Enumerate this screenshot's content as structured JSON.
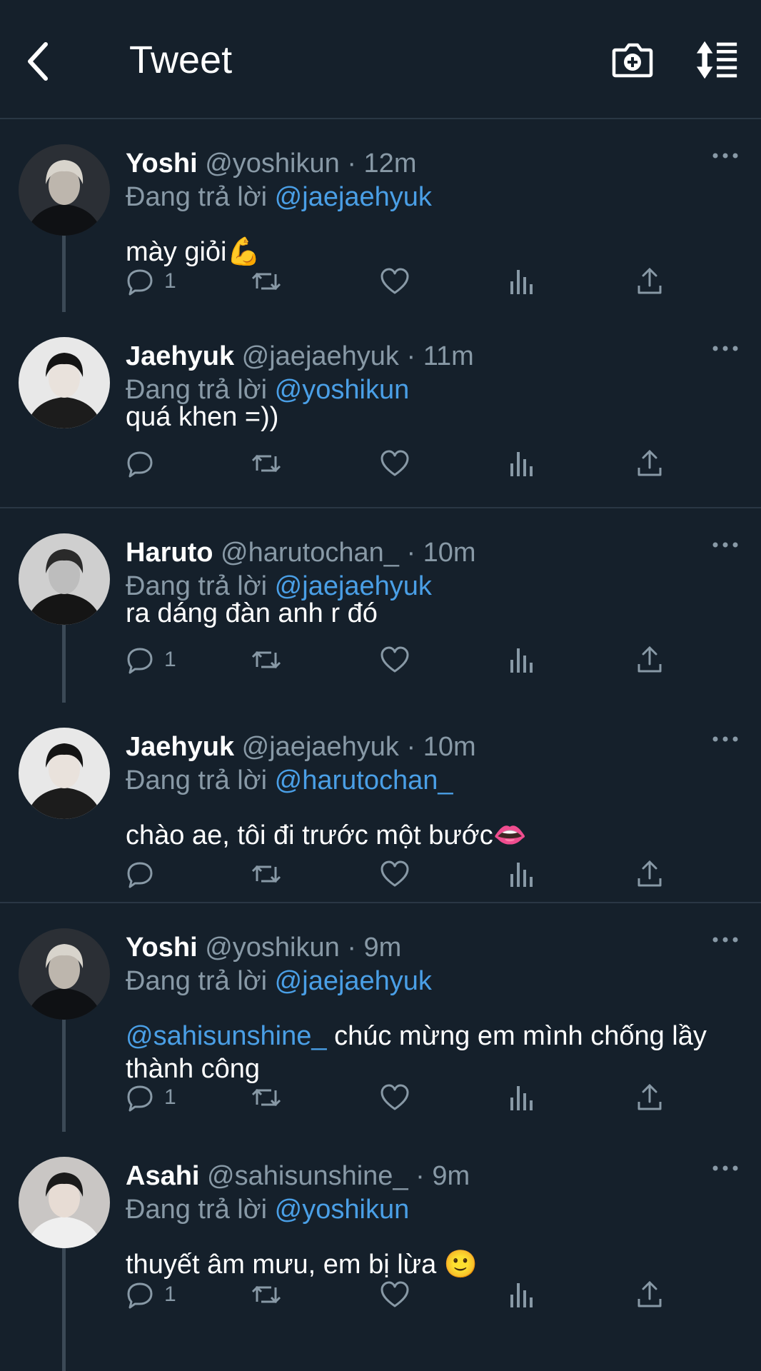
{
  "header": {
    "title": "Tweet"
  },
  "colors": {
    "background": "#15202b",
    "mention": "#4a9fe6",
    "secondary": "#8899a6"
  },
  "reply_prefix": "Đang trả lời",
  "tweets": [
    {
      "name": "Yoshi",
      "handle": "@yoshikun",
      "dot": "·",
      "time": "12m",
      "reply_to": "@jaejaehyuk",
      "mention": "",
      "text": "mày giỏi💪",
      "reply_count": "1"
    },
    {
      "name": "Jaehyuk",
      "handle": "@jaejaehyuk",
      "dot": "·",
      "time": "11m",
      "reply_to": "@yoshikun",
      "mention": "",
      "text": "quá khen =))",
      "reply_count": ""
    },
    {
      "name": "Haruto",
      "handle": "@harutochan_",
      "dot": "·",
      "time": "10m",
      "reply_to": "@jaejaehyuk",
      "mention": "",
      "text": "ra dáng đàn anh r đó",
      "reply_count": "1"
    },
    {
      "name": "Jaehyuk",
      "handle": "@jaejaehyuk",
      "dot": "·",
      "time": "10m",
      "reply_to": "@harutochan_",
      "mention": "",
      "text": "chào ae, tôi đi trước một bước👄",
      "reply_count": ""
    },
    {
      "name": "Yoshi",
      "handle": "@yoshikun",
      "dot": "·",
      "time": "9m",
      "reply_to": "@jaejaehyuk",
      "mention": "@sahisunshine_",
      "text": " chúc mừng em mình chống lầy thành công",
      "reply_count": "1"
    },
    {
      "name": "Asahi",
      "handle": "@sahisunshine_",
      "dot": "·",
      "time": "9m",
      "reply_to": "@yoshikun",
      "mention": "",
      "text": "thuyết âm mưu, em bị lừa 🙂",
      "reply_count": "1"
    }
  ]
}
